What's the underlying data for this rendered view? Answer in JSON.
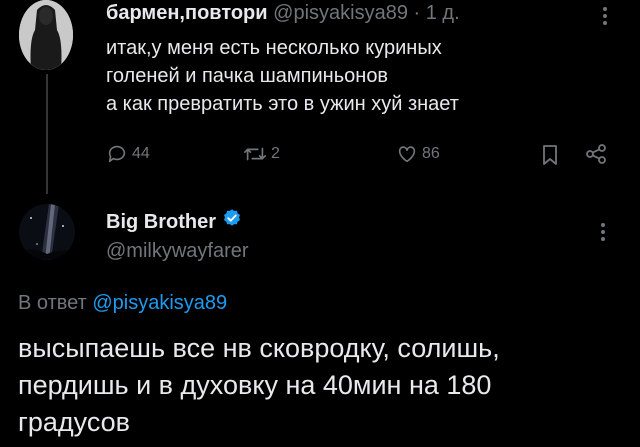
{
  "tweet": {
    "author_name": "бармен,повтори",
    "author_handle": "@pisyakisya89",
    "separator": "·",
    "time": "1 д.",
    "text_lines": [
      "итак,у меня есть несколько куриных",
      "голеней и пачка шампиньонов",
      "а как превратить это в ужин хуй знает"
    ],
    "replies": "44",
    "retweets": "2",
    "likes": "86"
  },
  "reply": {
    "author_name": "Big Brother",
    "author_handle": "@milkywayfarer",
    "reply_to_prefix": "В ответ",
    "reply_to_handle": "@pisyakisya89",
    "text_lines": [
      "высыпаешь все нв сковродку, солишь,",
      "пердишь и в духовку на 40мин на 180",
      "градусов"
    ]
  },
  "colors": {
    "background": "#000000",
    "text": "#e7e9ea",
    "muted": "#71767b",
    "accent": "#1d9bf0"
  },
  "icons": [
    "reply-icon",
    "retweet-icon",
    "like-icon",
    "bookmark-icon",
    "share-icon",
    "more-icon",
    "verified-badge-icon"
  ]
}
